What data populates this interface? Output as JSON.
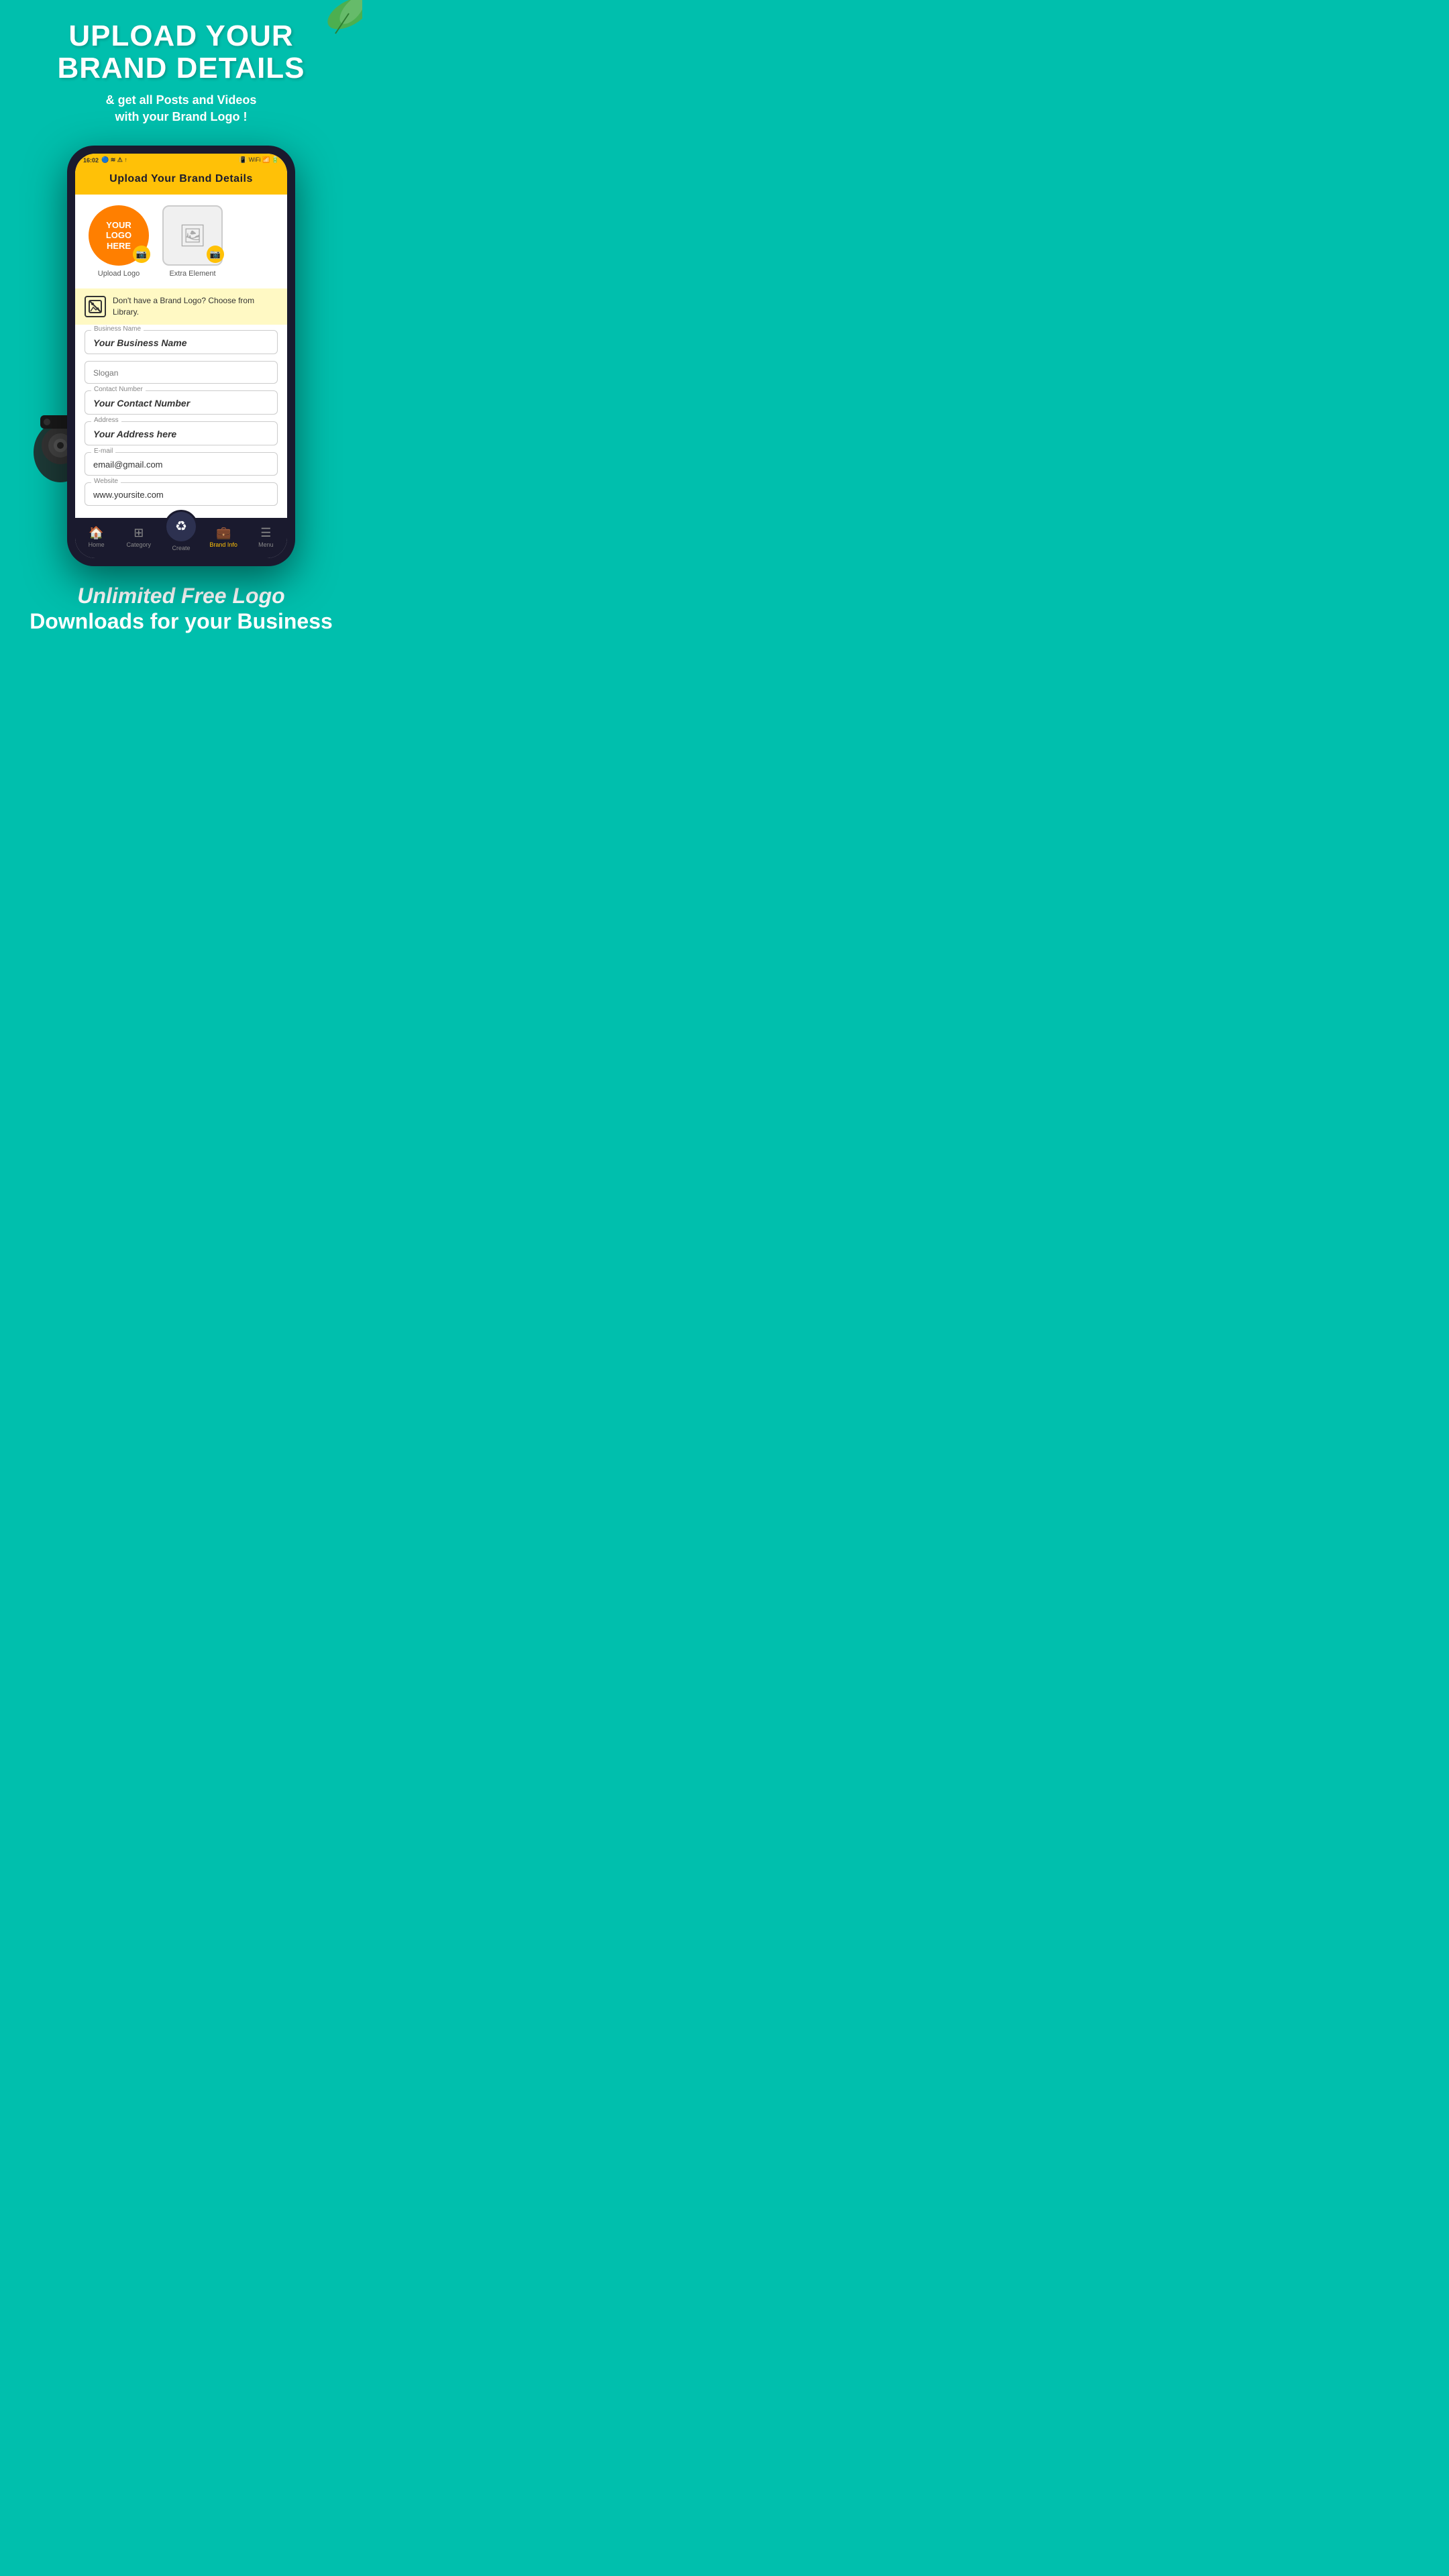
{
  "background_color": "#00BFAD",
  "hero": {
    "title_line1": "UPLOAD YOUR",
    "title_line2": "BRAND DETAILS",
    "subtitle": "& get all Posts and Videos",
    "subtitle2": "with your Brand Logo !"
  },
  "phone": {
    "status_bar": {
      "time": "16:02",
      "right_icons": "📶"
    },
    "header": {
      "title": "Upload  Your  Brand  Details"
    },
    "upload_area": {
      "logo_text_line1": "YOUR",
      "logo_text_line2": "LOGO",
      "logo_text_line3": "HERE",
      "upload_label": "Upload Logo",
      "extra_label": "Extra Element"
    },
    "info_banner": {
      "text": "Don't have a Brand Logo? Choose from Library."
    },
    "form": {
      "business_name_label": "Business Name",
      "business_name_value": "Your Business Name",
      "slogan_label": "Slogan",
      "slogan_placeholder": "Slogan",
      "contact_label": "Contact Number",
      "contact_value": "Your Contact Number",
      "address_label": "Address",
      "address_value": "Your Address here",
      "email_label": "E-mail",
      "email_value": "email@gmail.com",
      "website_label": "Website",
      "website_value": "www.yoursite.com"
    },
    "nav": {
      "home_label": "Home",
      "category_label": "Category",
      "create_label": "Create",
      "brand_info_label": "Brand Info",
      "menu_label": "Menu"
    }
  },
  "bottom": {
    "line1": "Unlimited Free Logo",
    "line2": "Downloads for your Business"
  }
}
